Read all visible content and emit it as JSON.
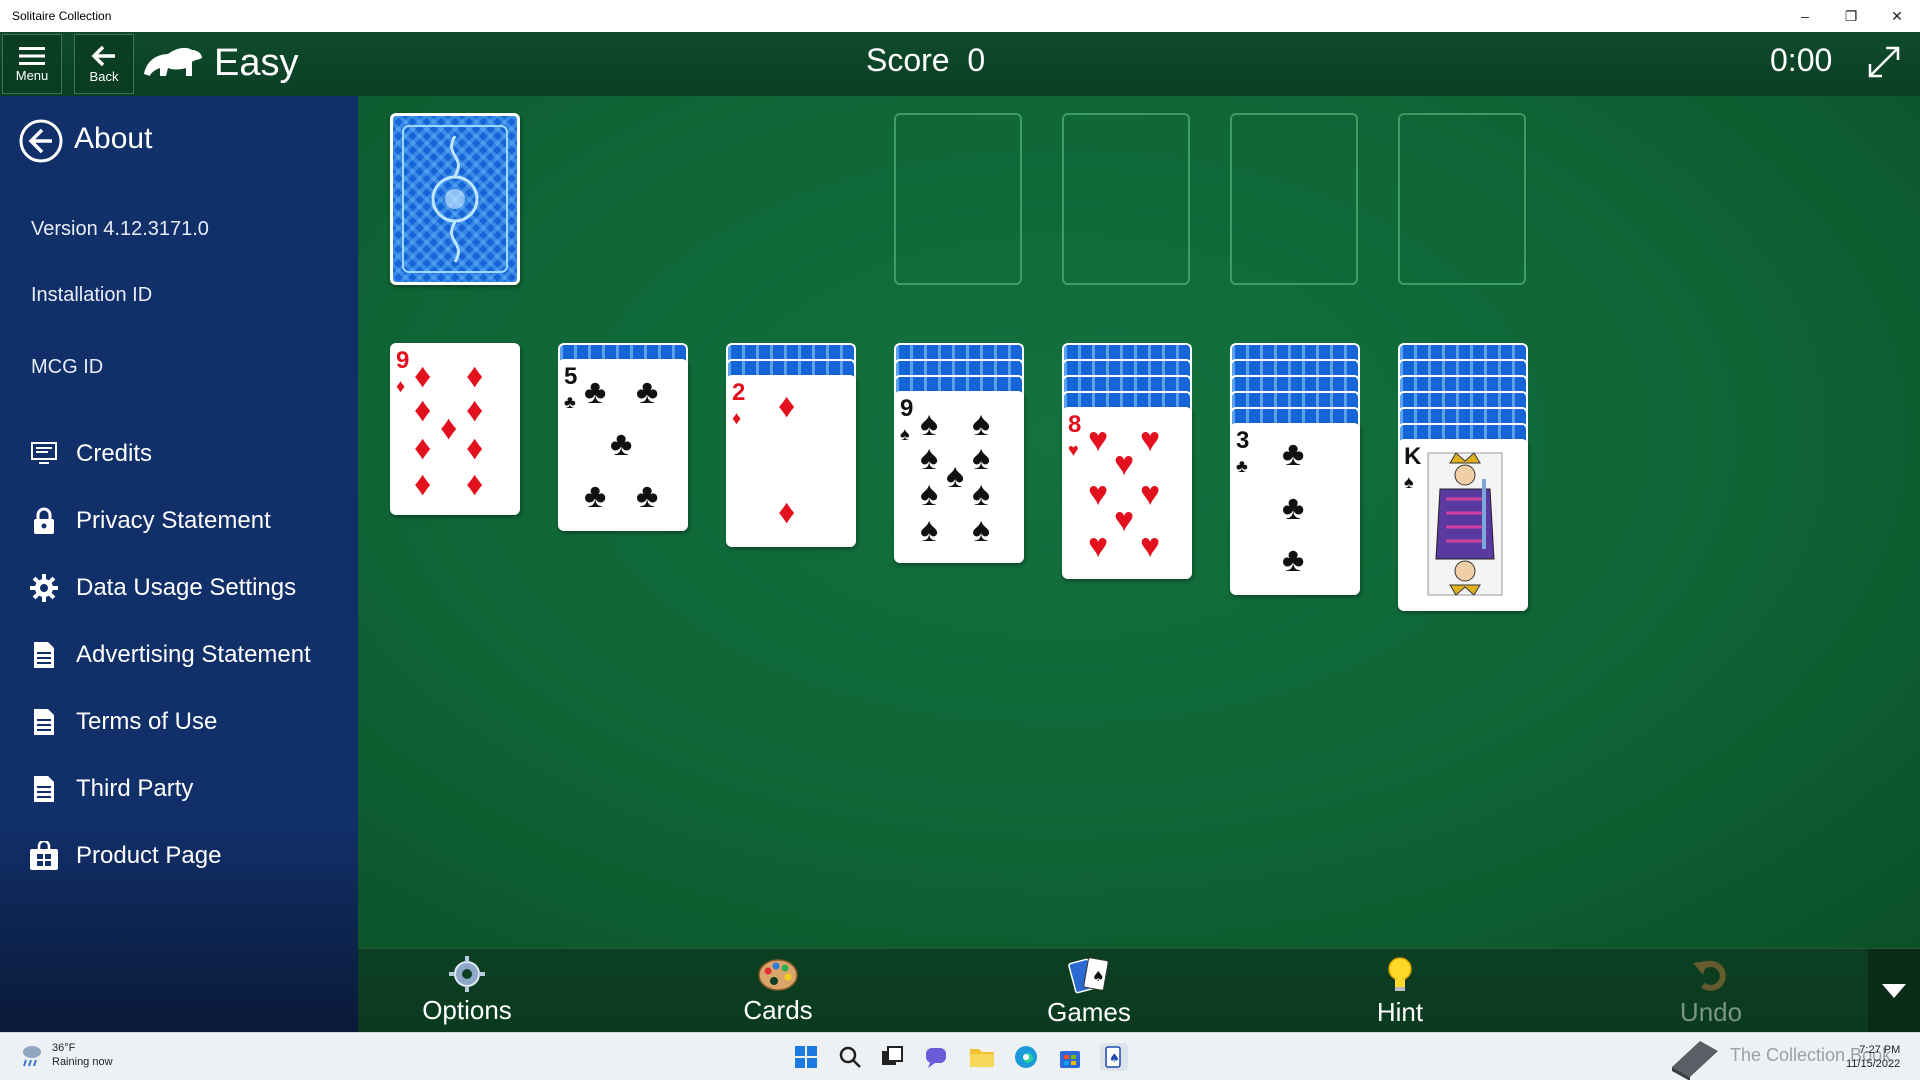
{
  "window": {
    "title": "Solitaire Collection",
    "min": "–",
    "max": "❐",
    "close": "✕"
  },
  "header": {
    "menu_label": "Menu",
    "back_label": "Back",
    "difficulty": "Easy",
    "score_label": "Score",
    "score_value": "0",
    "timer": "0:00"
  },
  "sidebar": {
    "title": "About",
    "version": "Version 4.12.3171.0",
    "installation_id": "Installation ID",
    "mcg_id": "MCG ID",
    "items": [
      {
        "label": "Credits",
        "icon": "monitor-icon"
      },
      {
        "label": "Privacy Statement",
        "icon": "lock-icon"
      },
      {
        "label": "Data Usage Settings",
        "icon": "gear-icon"
      },
      {
        "label": "Advertising Statement",
        "icon": "document-icon"
      },
      {
        "label": "Terms of Use",
        "icon": "document-icon"
      },
      {
        "label": "Third Party",
        "icon": "document-icon"
      },
      {
        "label": "Product Page",
        "icon": "store-icon"
      }
    ]
  },
  "game": {
    "foundations": 4,
    "tableau": [
      {
        "hidden": 0,
        "rank": "9",
        "suit": "♦"
      },
      {
        "hidden": 1,
        "rank": "5",
        "suit": "♣"
      },
      {
        "hidden": 2,
        "rank": "2",
        "suit": "♦"
      },
      {
        "hidden": 3,
        "rank": "9",
        "suit": "♠"
      },
      {
        "hidden": 4,
        "rank": "8",
        "suit": "♥"
      },
      {
        "hidden": 5,
        "rank": "3",
        "suit": "♣"
      },
      {
        "hidden": 6,
        "rank": "K",
        "suit": "♠"
      }
    ]
  },
  "toolbar": {
    "options": "Options",
    "cards": "Cards",
    "games": "Games",
    "hint": "Hint",
    "undo": "Undo"
  },
  "taskbar": {
    "temperature": "36°F",
    "weather": "Raining now",
    "time": "7:27 PM",
    "date": "11/15/2022",
    "watermark": "The Collection Book"
  },
  "colors": {
    "felt": "#0f6535",
    "sidebar": "#112f68",
    "header": "#0f4a2b",
    "red_suit": "#e3101e"
  }
}
